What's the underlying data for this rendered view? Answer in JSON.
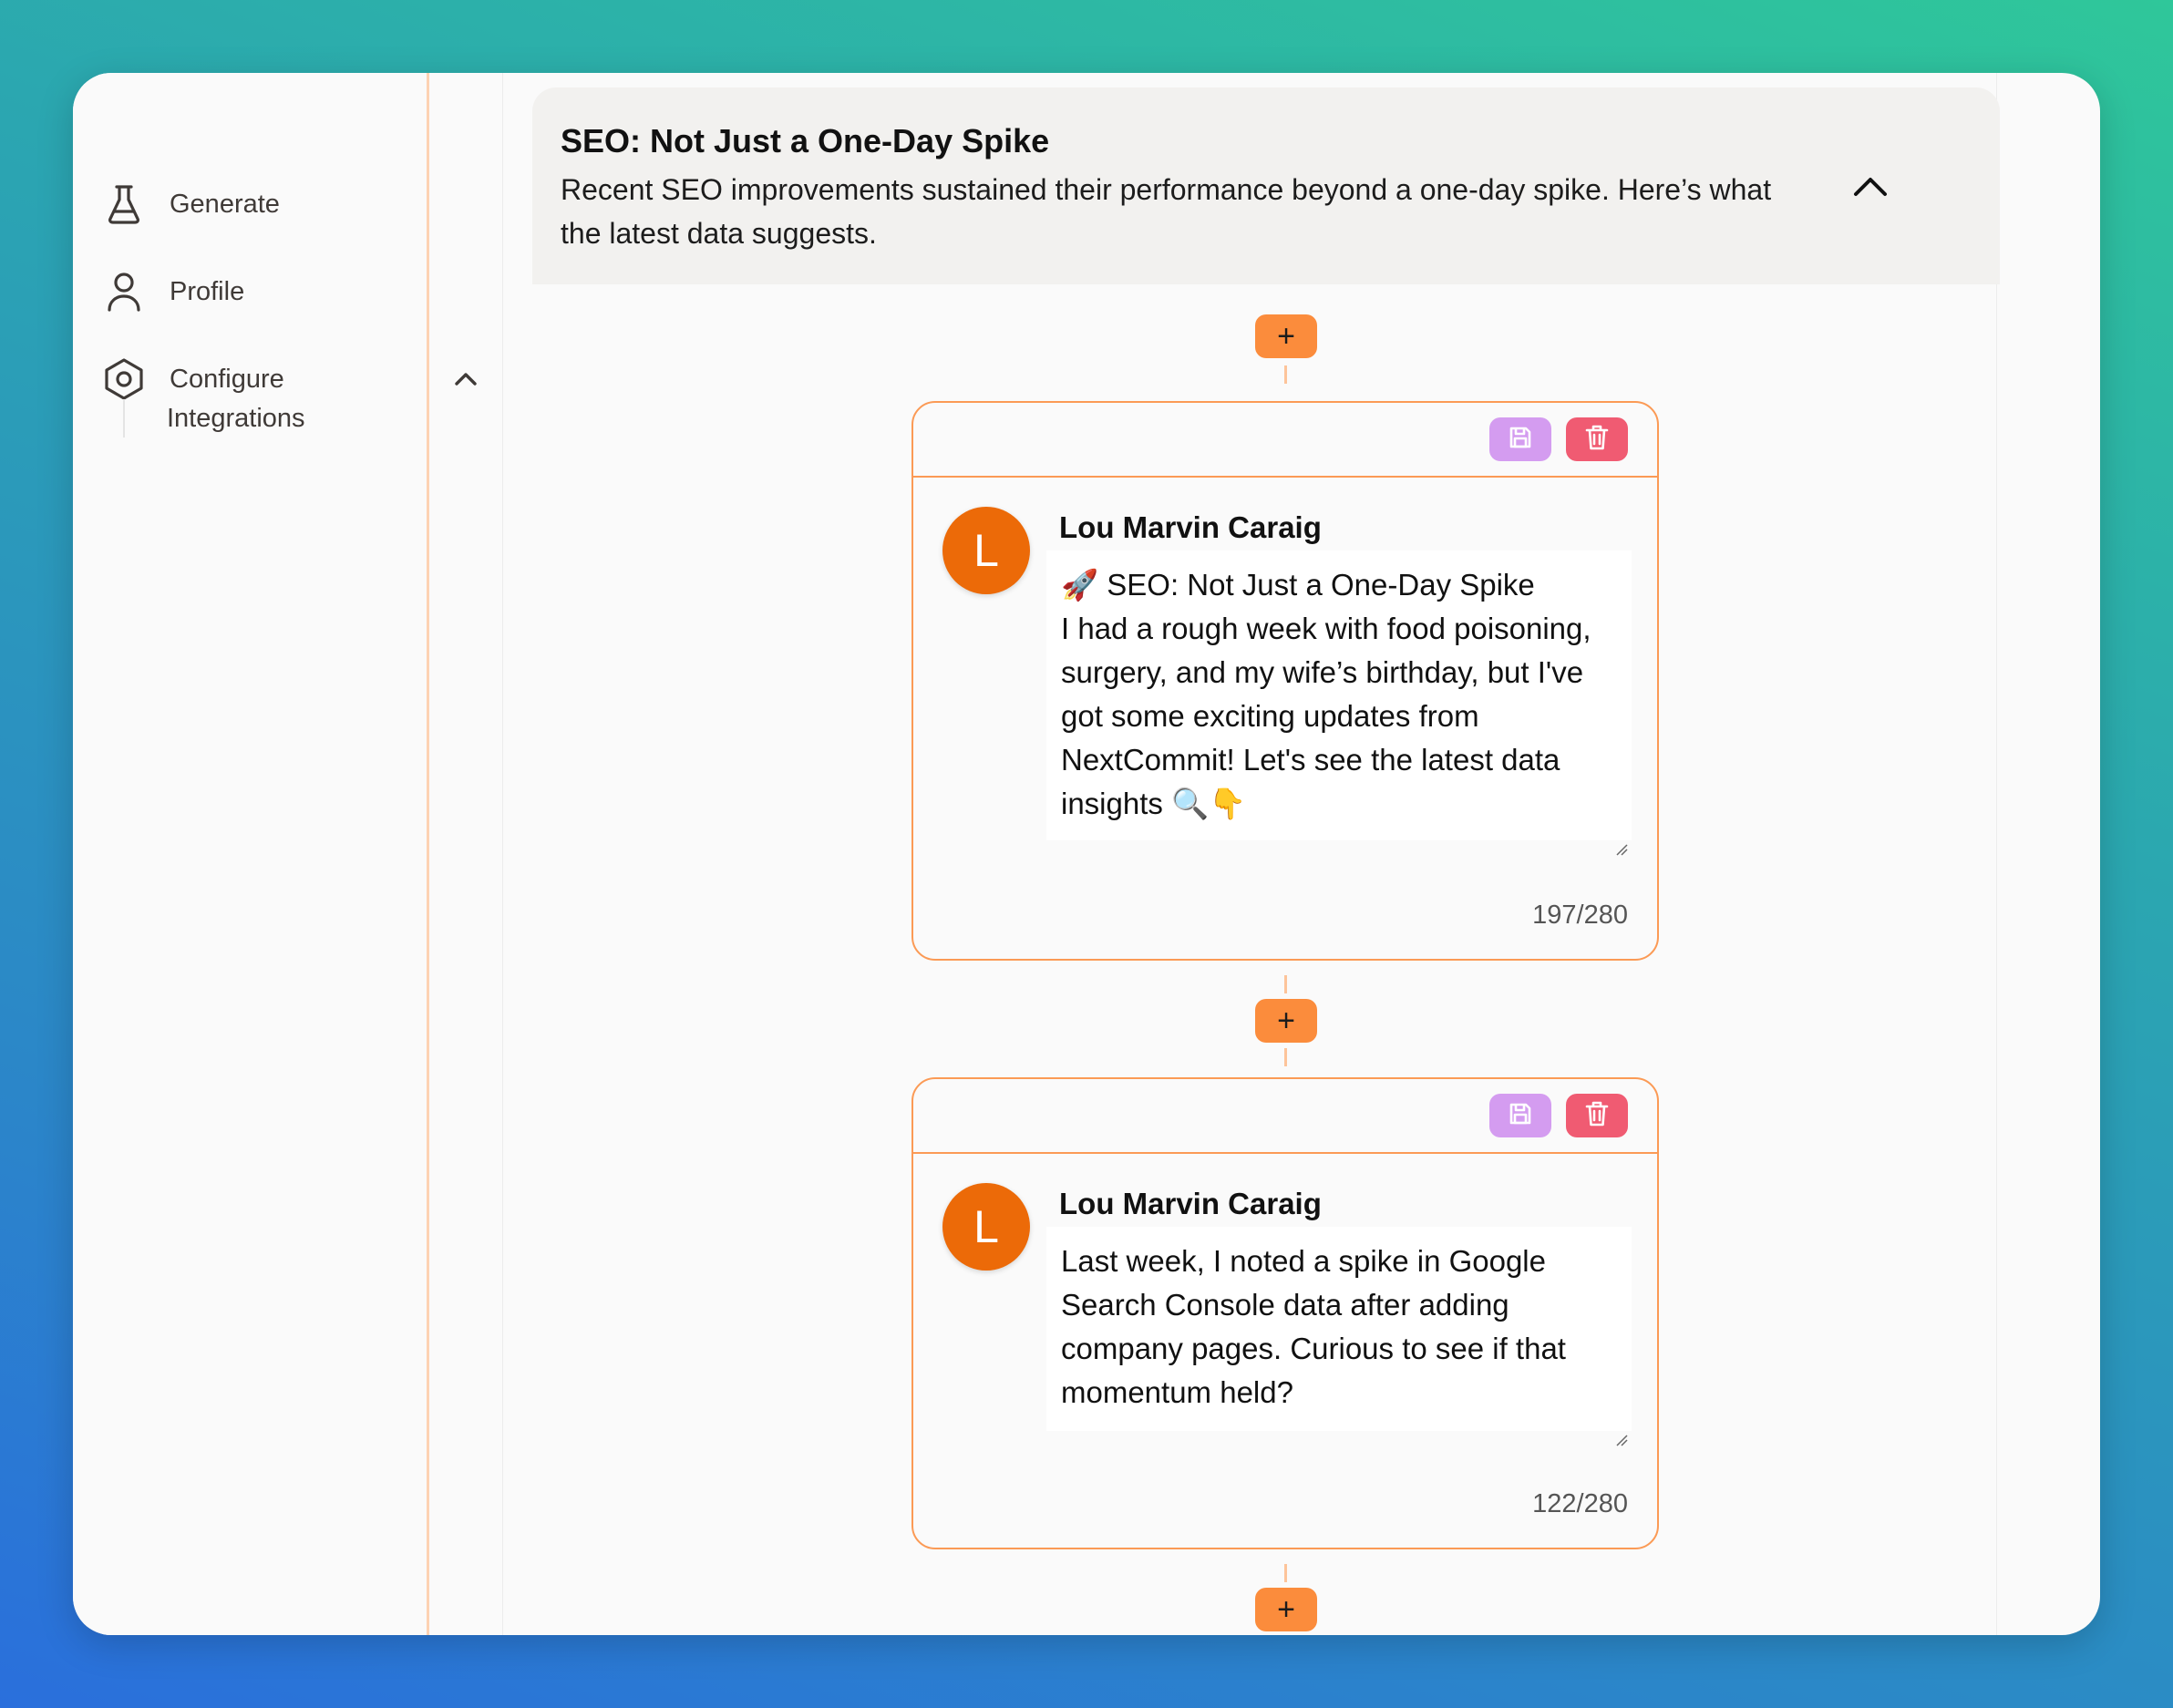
{
  "sidebar": {
    "items": [
      {
        "label": "Generate",
        "icon": "flask-icon"
      },
      {
        "label": "Profile",
        "icon": "user-icon"
      },
      {
        "label": "Configure",
        "icon": "hexagon-settings-icon"
      }
    ],
    "sub_items": [
      {
        "label": "Integrations"
      }
    ]
  },
  "summary": {
    "title": "SEO: Not Just a One-Day Spike",
    "description": "Recent SEO improvements sustained their performance beyond a one-day spike. Here’s what the latest data suggests."
  },
  "add_label": "+",
  "posts": [
    {
      "author": "Lou Marvin Caraig",
      "avatar_letter": "L",
      "text_line1": "🚀 SEO: Not Just a One-Day Spike",
      "text_body": "I had a rough week with food poisoning, surgery, and my wife’s birthday, but I've got some exciting updates from NextCommit! Let's see the latest data insights 🔍👇",
      "char_count": "197/280"
    },
    {
      "author": "Lou Marvin Caraig",
      "avatar_letter": "L",
      "text_body": "Last week, I noted a spike in Google Search Console data after adding company pages. Curious to see if that momentum held?",
      "char_count": "122/280"
    }
  ],
  "colors": {
    "accent": "#fb8c3c",
    "save": "#d49cf0",
    "delete": "#f05b72",
    "avatar": "#ec6a08"
  }
}
